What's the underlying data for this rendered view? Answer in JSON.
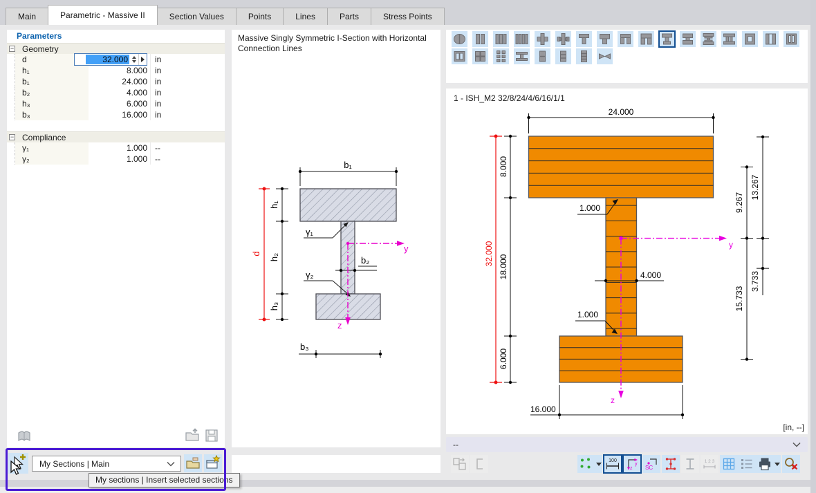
{
  "tabs": [
    {
      "label": "Main",
      "active": false
    },
    {
      "label": "Parametric - Massive II",
      "active": true
    },
    {
      "label": "Section Values",
      "active": false
    },
    {
      "label": "Points",
      "active": false
    },
    {
      "label": "Lines",
      "active": false
    },
    {
      "label": "Parts",
      "active": false
    },
    {
      "label": "Stress Points",
      "active": false
    }
  ],
  "parameters": {
    "title": "Parameters",
    "groups": [
      {
        "name": "Geometry",
        "rows": [
          {
            "label": "d",
            "value": "32.000",
            "unit": "in",
            "editing": true
          },
          {
            "label": "h₁",
            "value": "8.000",
            "unit": "in"
          },
          {
            "label": "b₁",
            "value": "24.000",
            "unit": "in"
          },
          {
            "label": "b₂",
            "value": "4.000",
            "unit": "in"
          },
          {
            "label": "h₃",
            "value": "6.000",
            "unit": "in"
          },
          {
            "label": "b₃",
            "value": "16.000",
            "unit": "in"
          }
        ]
      },
      {
        "name": "Compliance",
        "rows": [
          {
            "label": "γ₁",
            "value": "1.000",
            "unit": "--"
          },
          {
            "label": "γ₂",
            "value": "1.000",
            "unit": "--"
          }
        ]
      }
    ]
  },
  "middle": {
    "title_line1": "Massive Singly Symmetric I-Section with Horizontal",
    "title_line2": "Connection Lines",
    "labels": {
      "b1": "b₁",
      "b2": "b₂",
      "b3": "b₃",
      "h1": "h₁",
      "h2": "h₂",
      "h3": "h₃",
      "d": "d",
      "g1": "γ₁",
      "g2": "γ₂",
      "y": "y",
      "z": "z"
    }
  },
  "right": {
    "section_label": "1 - ISH_M2 32/8/24/4/6/16/1/1",
    "icons_row1": [
      "rounded-2part",
      "bars-2",
      "bars-3",
      "bars-4",
      "cross-1",
      "cross-2",
      "tee-1",
      "tee-2",
      "u-channel-1",
      "u-channel-2",
      "i-singly-symmetric",
      "i-symmetric",
      "i-double-flange",
      "i-two-webs",
      "box-hole",
      "box-slot",
      "box-bars"
    ],
    "icons_row2": [
      "window-2pane",
      "grid-4",
      "grid-6",
      "i-beam-h",
      "stack-2",
      "stack-3",
      "stack-4",
      "bowtie"
    ],
    "selected_icon_index": 10,
    "dims": {
      "b_top": "24.000",
      "h_top": "8.000",
      "h_web": "18.000",
      "h_bot": "6.000",
      "d_total": "32.000",
      "w_web": "4.000",
      "b_bot": "16.000",
      "e_top": "13.267",
      "e_tf": "9.267",
      "e_bf": "15.733",
      "e_web": "3.733",
      "conn_top": "1.000",
      "conn_bot": "1.000",
      "units": "[in, --]",
      "axis_y": "y",
      "axis_z": "z"
    },
    "result_value": "--",
    "toolbar": [
      {
        "name": "copy-to-model",
        "dis": true
      },
      {
        "name": "section-shape",
        "dis": true
      },
      {
        "name": "points-display",
        "caret": true
      },
      {
        "name": "dimensions",
        "sel": true
      },
      {
        "name": "axes",
        "sel": true
      },
      {
        "name": "shear-center"
      },
      {
        "name": "stress-points"
      },
      {
        "name": "profile-gray",
        "dis": true
      },
      {
        "name": "numbering-123",
        "dis": true
      },
      {
        "name": "grid"
      },
      {
        "name": "details-list"
      },
      {
        "name": "print",
        "caret": true
      },
      {
        "name": "zoom-reset"
      }
    ]
  },
  "bottom": {
    "sections_dropdown": "My Sections | Main",
    "insert_tooltip": "My sections | Insert selected sections"
  }
}
